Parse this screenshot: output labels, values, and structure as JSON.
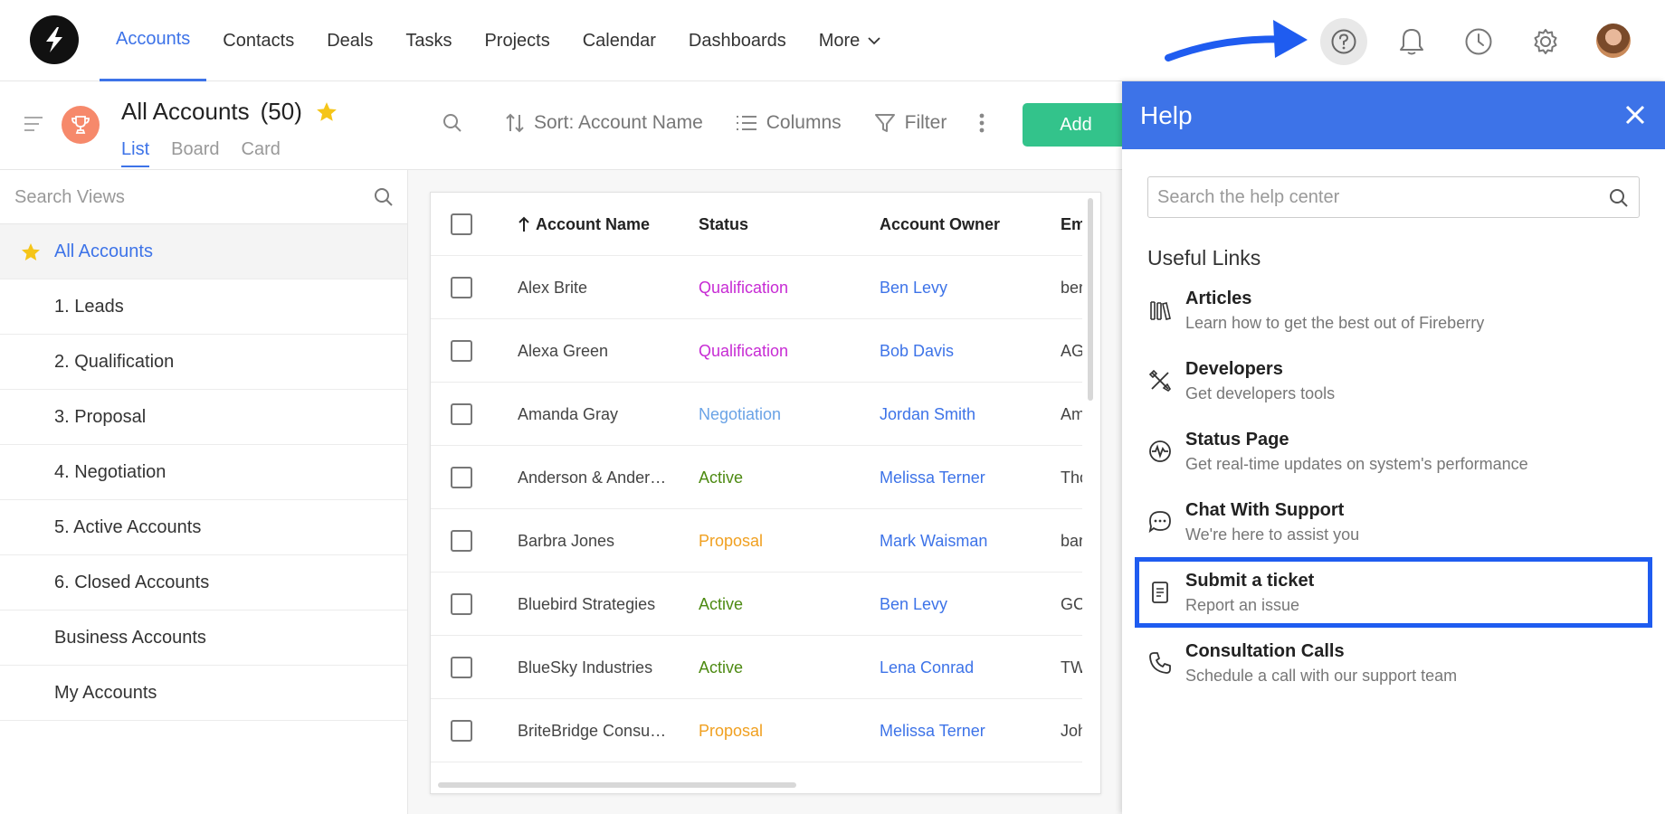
{
  "nav": {
    "items": [
      "Accounts",
      "Contacts",
      "Deals",
      "Tasks",
      "Projects",
      "Calendar",
      "Dashboards"
    ],
    "more_label": "More"
  },
  "view": {
    "title": "All Accounts",
    "count": "(50)",
    "tabs": [
      "List",
      "Board",
      "Card"
    ]
  },
  "toolbar": {
    "sort_label": "Sort: Account Name",
    "columns_label": "Columns",
    "filter_label": "Filter",
    "add_label": "Add"
  },
  "sidebar": {
    "search_placeholder": "Search Views",
    "items": [
      "All Accounts",
      "1. Leads",
      "2. Qualification",
      "3. Proposal",
      "4. Negotiation",
      "5. Active Accounts",
      "6. Closed Accounts",
      "Business Accounts",
      "My Accounts"
    ]
  },
  "table": {
    "headers": [
      "Account Name",
      "Status",
      "Account Owner",
      "Em"
    ],
    "rows": [
      {
        "name": "Alex Brite",
        "status": "Qualification",
        "owner": "Ben Levy",
        "email": "ber"
      },
      {
        "name": "Alexa Green",
        "status": "Qualification",
        "owner": "Bob Davis",
        "email": "AG"
      },
      {
        "name": "Amanda Gray",
        "status": "Negotiation",
        "owner": "Jordan Smith",
        "email": "Am"
      },
      {
        "name": "Anderson & Ander…",
        "status": "Active",
        "owner": "Melissa Terner",
        "email": "Tho"
      },
      {
        "name": "Barbra Jones",
        "status": "Proposal",
        "owner": "Mark Waisman",
        "email": "bar"
      },
      {
        "name": "Bluebird Strategies",
        "status": "Active",
        "owner": "Ben Levy",
        "email": "GC"
      },
      {
        "name": "BlueSky Industries",
        "status": "Active",
        "owner": "Lena Conrad",
        "email": "TW"
      },
      {
        "name": "BriteBridge Consu…",
        "status": "Proposal",
        "owner": "Melissa Terner",
        "email": "Joh"
      }
    ]
  },
  "status_colors": {
    "Qualification": "#c72bd4",
    "Negotiation": "#6aa3e6",
    "Active": "#4d8a12",
    "Proposal": "#f0a020"
  },
  "help": {
    "title": "Help",
    "search_placeholder": "Search the help center",
    "useful_links_title": "Useful Links",
    "links": [
      {
        "icon": "books-icon",
        "title": "Articles",
        "subtitle": "Learn how to get the best out of Fireberry"
      },
      {
        "icon": "tools-icon",
        "title": "Developers",
        "subtitle": "Get developers tools"
      },
      {
        "icon": "pulse-icon",
        "title": "Status Page",
        "subtitle": "Get real-time updates on system's performance"
      },
      {
        "icon": "chat-icon",
        "title": "Chat With Support",
        "subtitle": "We're here to assist you"
      },
      {
        "icon": "document-icon",
        "title": "Submit a ticket",
        "subtitle": "Report an issue"
      },
      {
        "icon": "phone-icon",
        "title": "Consultation Calls",
        "subtitle": "Schedule a call with our support team"
      }
    ]
  },
  "colors": {
    "accent": "#3d73e8",
    "add_button": "#33c38b",
    "highlight_annotation": "#1f5cf0"
  }
}
